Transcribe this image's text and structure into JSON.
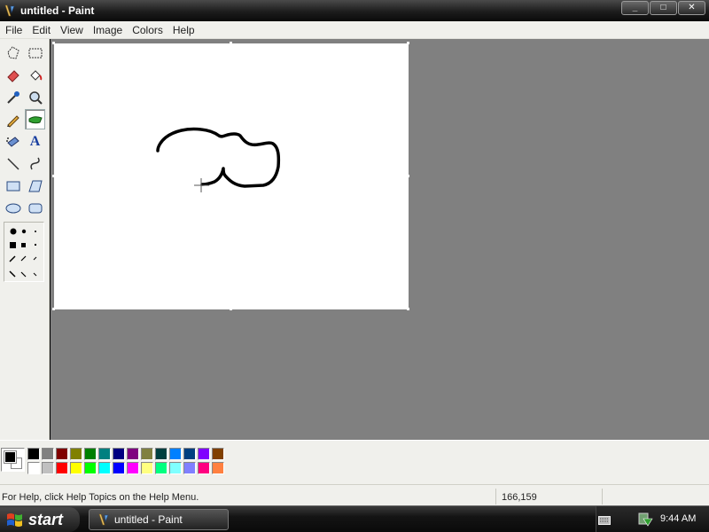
{
  "window": {
    "title": "untitled - Paint",
    "controls": {
      "minimize": "_",
      "maximize": "□",
      "close": "✕"
    }
  },
  "menu": [
    "File",
    "Edit",
    "View",
    "Image",
    "Colors",
    "Help"
  ],
  "tools": [
    {
      "name": "free-form-select",
      "icon": "free-select-icon"
    },
    {
      "name": "select",
      "icon": "rect-select-icon"
    },
    {
      "name": "eraser",
      "icon": "eraser-icon"
    },
    {
      "name": "fill-with-color",
      "icon": "paint-bucket-icon"
    },
    {
      "name": "pick-color",
      "icon": "eyedropper-icon"
    },
    {
      "name": "magnifier",
      "icon": "magnifier-icon"
    },
    {
      "name": "pencil",
      "icon": "pencil-icon"
    },
    {
      "name": "brush",
      "icon": "brush-icon",
      "active": true
    },
    {
      "name": "airbrush",
      "icon": "airbrush-icon"
    },
    {
      "name": "text",
      "icon": "text-icon",
      "glyph": "A"
    },
    {
      "name": "line",
      "icon": "line-icon"
    },
    {
      "name": "curve",
      "icon": "curve-icon"
    },
    {
      "name": "rectangle",
      "icon": "rectangle-icon"
    },
    {
      "name": "polygon",
      "icon": "polygon-icon"
    },
    {
      "name": "ellipse",
      "icon": "ellipse-icon"
    },
    {
      "name": "rounded-rectangle",
      "icon": "rounded-rect-icon"
    }
  ],
  "palette": {
    "foreground": "#000000",
    "background": "#ffffff",
    "row1": [
      "#000000",
      "#808080",
      "#800000",
      "#808000",
      "#008000",
      "#008080",
      "#000080",
      "#800080",
      "#808040",
      "#004040",
      "#0080ff",
      "#004080",
      "#8000ff",
      "#804000"
    ],
    "row2": [
      "#ffffff",
      "#c0c0c0",
      "#ff0000",
      "#ffff00",
      "#00ff00",
      "#00ffff",
      "#0000ff",
      "#ff00ff",
      "#ffff80",
      "#00ff80",
      "#80ffff",
      "#8080ff",
      "#ff0080",
      "#ff8040"
    ]
  },
  "status": {
    "help": "For Help, click Help Topics on the Help Menu.",
    "coords": "166,159"
  },
  "taskbar": {
    "start": "start",
    "task": "untitled - Paint",
    "clock": "9:44 AM"
  }
}
